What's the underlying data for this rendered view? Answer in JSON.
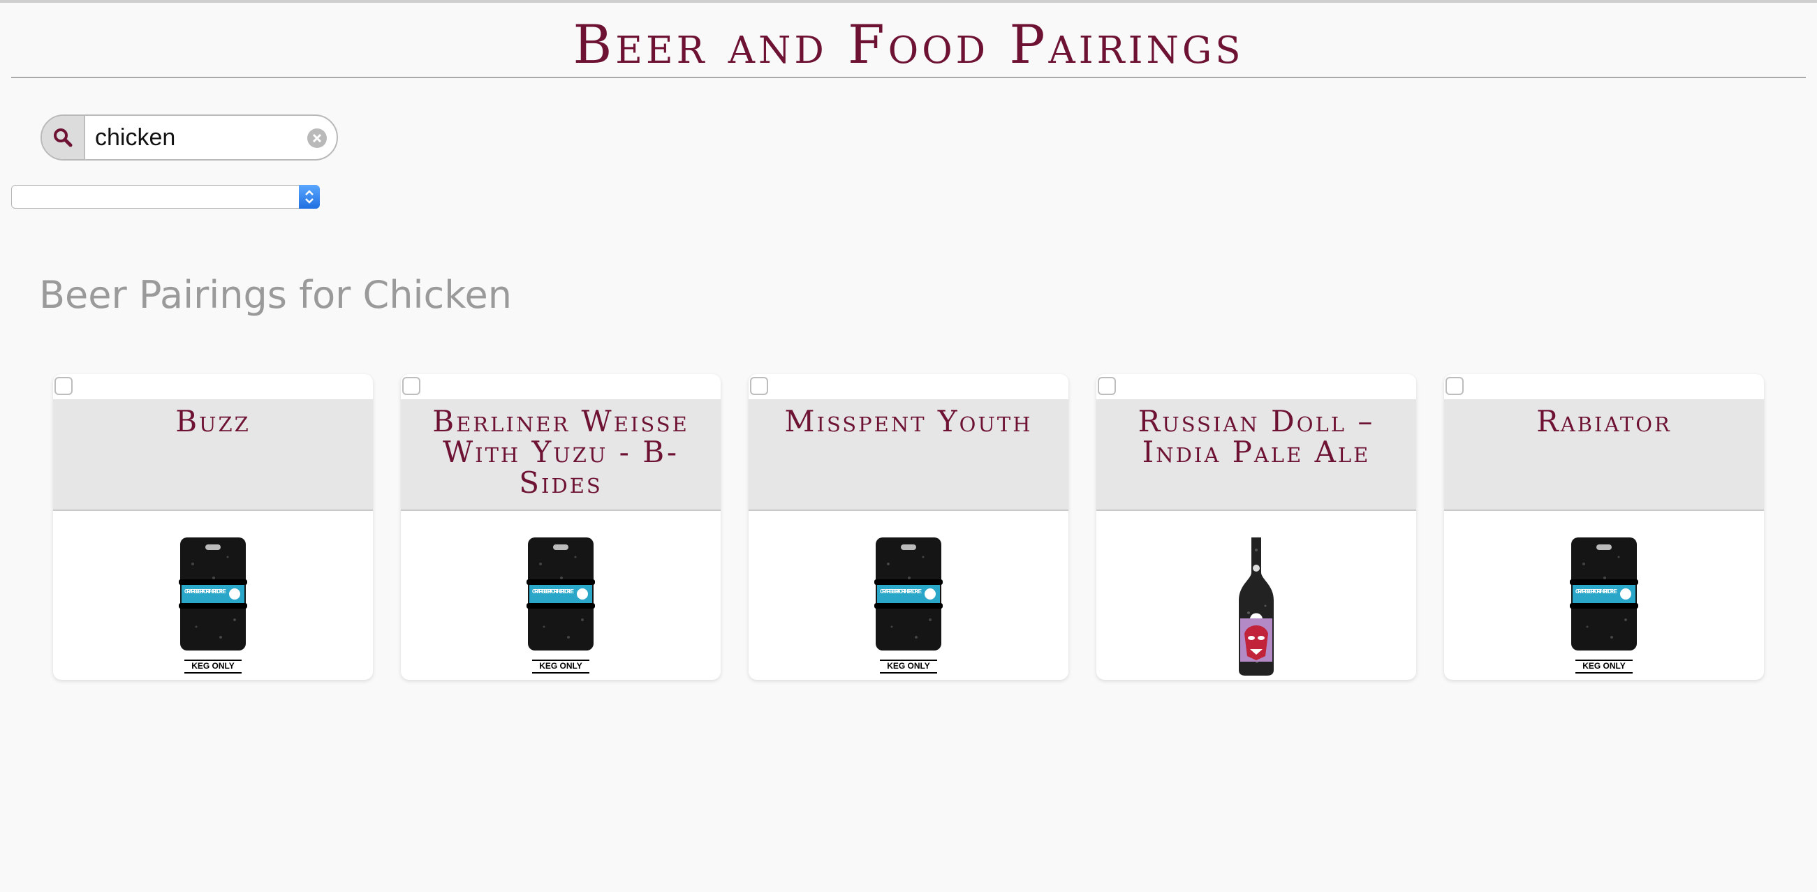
{
  "header": {
    "title": "Beer and Food Pairings"
  },
  "search": {
    "value": "chicken"
  },
  "icons": {
    "search": "search-icon",
    "clear": "clear-icon",
    "select": "select-arrows-icon"
  },
  "results": {
    "heading": "Beer Pairings for Chicken",
    "beers": [
      {
        "name": "Buzz",
        "image": "keg",
        "label": "KEG ONLY",
        "keg_text": "CRAFT BEER FOR THE PEOPLE"
      },
      {
        "name": "Berliner Weisse With Yuzu - B-Sides",
        "image": "keg",
        "label": "KEG ONLY",
        "keg_text": "CRAFT BEER FOR THE PEOPLE"
      },
      {
        "name": "Misspent Youth",
        "image": "keg",
        "label": "KEG ONLY",
        "keg_text": "CRAFT BEER FOR THE PEOPLE"
      },
      {
        "name": "Russian Doll – India Pale Ale",
        "image": "bottle"
      },
      {
        "name": "Rabiator",
        "image": "keg",
        "label": "KEG ONLY",
        "keg_text": "CRAFT BEER FOR THE PEOPLE"
      }
    ]
  },
  "colors": {
    "accent": "#6e1234",
    "keg_band": "#2aa6c9",
    "bottle_label": "#b48ac6"
  }
}
